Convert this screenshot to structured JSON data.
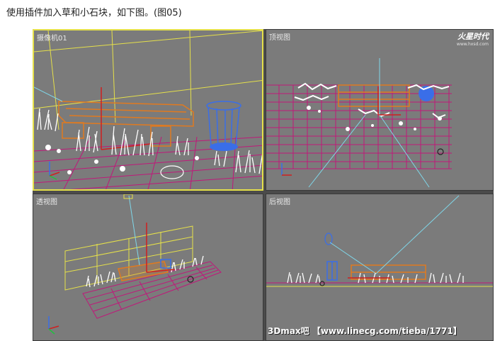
{
  "caption": "使用插件加入草和小石块，如下图。(图05)",
  "viewports": {
    "camera": {
      "label": "摄像机01"
    },
    "top": {
      "label": "顶视图"
    },
    "perspective": {
      "label": "透视图"
    },
    "back": {
      "label": "后视图"
    }
  },
  "logo": {
    "name": "火星时代",
    "url": "www.hxsd.com"
  },
  "watermark": "3Dmax吧 【www.linecg.com/tieba/1771】",
  "colors": {
    "viewport_bg": "#7b7b7b",
    "active_border": "#e5e04a",
    "grid": "#c0187a",
    "bench": "#e07a20",
    "grass": "#ffffff",
    "trash_bin": "#3a6ee8"
  }
}
